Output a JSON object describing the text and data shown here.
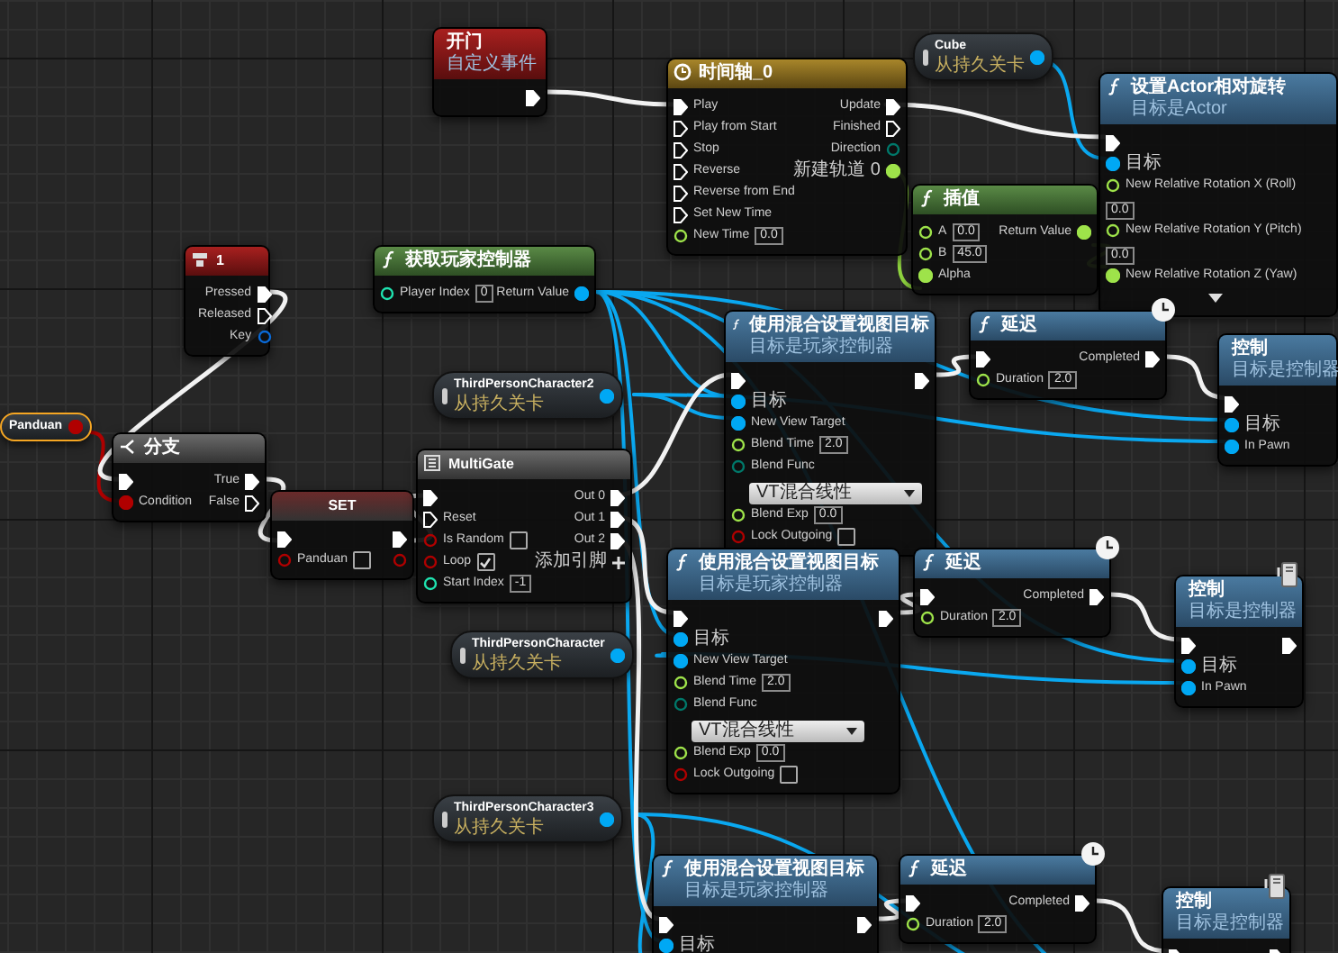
{
  "nodes": [
    {
      "kind": "event",
      "title": "开门",
      "subtitle": "自定义事件",
      "selected": false,
      "outputs": [
        {
          "kind": "exec",
          "connected": true
        }
      ]
    },
    {
      "kind": "timeline",
      "title": "时间轴_0",
      "selected": false,
      "inputs": [
        {
          "label": "Play",
          "kind": "exec",
          "connected": true
        },
        {
          "label": "Play from Start",
          "kind": "exec",
          "connected": false
        },
        {
          "label": "Stop",
          "kind": "exec",
          "connected": false
        },
        {
          "label": "Reverse",
          "kind": "exec",
          "connected": false
        },
        {
          "label": "Reverse from End",
          "kind": "exec",
          "connected": false
        },
        {
          "label": "Set New Time",
          "kind": "exec",
          "connected": false
        },
        {
          "label": "New Time",
          "kind": "float",
          "connected": false,
          "value": "0.0"
        }
      ],
      "outputs": [
        {
          "label": "Update",
          "kind": "exec",
          "connected": true
        },
        {
          "label": "Finished",
          "kind": "exec",
          "connected": false
        },
        {
          "label": "Direction",
          "kind": "byte",
          "connected": false
        },
        {
          "label": "新建轨道 0",
          "kind": "float",
          "connected": true
        }
      ]
    },
    {
      "kind": "variable",
      "title": "Cube",
      "subtitle": "从持久关卡",
      "selected": false,
      "outputs": [
        {
          "kind": "object",
          "connected": true
        }
      ]
    },
    {
      "kind": "function",
      "title": "设置Actor相对旋转",
      "subtitle": "目标是Actor",
      "selected": false,
      "inputs": [
        {
          "kind": "exec",
          "connected": true
        },
        {
          "label": "目标",
          "kind": "object",
          "connected": true
        },
        {
          "label": "New Relative Rotation X (Roll)",
          "kind": "float",
          "connected": false,
          "value": "0.0"
        },
        {
          "label": "New Relative Rotation Y (Pitch)",
          "kind": "float",
          "connected": false,
          "value": "0.0"
        },
        {
          "label": "New Relative Rotation Z (Yaw)",
          "kind": "float",
          "connected": true
        },
        {
          "kind": "expander"
        }
      ]
    },
    {
      "kind": "input_key",
      "title": "1",
      "selected": false,
      "outputs": [
        {
          "label": "Pressed",
          "kind": "exec",
          "connected": true
        },
        {
          "label": "Released",
          "kind": "exec",
          "connected": false
        },
        {
          "label": "Key",
          "kind": "struct",
          "connected": false
        }
      ]
    },
    {
      "kind": "pure_function",
      "title": "获取玩家控制器",
      "selected": false,
      "inputs": [
        {
          "label": "Player Index",
          "kind": "int",
          "connected": false,
          "value": "0"
        }
      ],
      "outputs": [
        {
          "label": "Return Value",
          "kind": "object",
          "connected": true
        }
      ]
    },
    {
      "kind": "pure_function",
      "title": "插值",
      "selected": false,
      "inputs": [
        {
          "label": "A",
          "kind": "float",
          "connected": false,
          "value": "0.0"
        },
        {
          "label": "B",
          "kind": "float",
          "connected": false,
          "value": "45.0"
        },
        {
          "label": "Alpha",
          "kind": "float",
          "connected": true
        }
      ],
      "outputs": [
        {
          "label": "Return Value",
          "kind": "float",
          "connected": true
        }
      ]
    },
    {
      "kind": "variable",
      "title": "ThirdPersonCharacter2",
      "subtitle": "从持久关卡",
      "selected": false,
      "outputs": [
        {
          "kind": "object",
          "connected": true
        }
      ]
    },
    {
      "kind": "variable",
      "title": "Panduan",
      "selected": true,
      "outputs": [
        {
          "kind": "bool",
          "connected": true
        }
      ]
    },
    {
      "kind": "branch",
      "title": "分支",
      "selected": false,
      "inputs": [
        {
          "kind": "exec",
          "connected": true
        },
        {
          "label": "Condition",
          "kind": "bool",
          "connected": true
        }
      ],
      "outputs": [
        {
          "label": "True",
          "kind": "exec",
          "connected": true
        },
        {
          "label": "False",
          "kind": "exec",
          "connected": false
        }
      ]
    },
    {
      "kind": "set",
      "title": "SET",
      "selected": false,
      "inputs": [
        {
          "kind": "exec",
          "connected": true
        },
        {
          "label": "Panduan",
          "kind": "bool",
          "connected": false,
          "checked": false
        }
      ],
      "outputs": [
        {
          "kind": "exec",
          "connected": true
        },
        {
          "kind": "bool",
          "connected": false
        }
      ]
    },
    {
      "kind": "macro",
      "title": "MultiGate",
      "selected": false,
      "inputs": [
        {
          "kind": "exec",
          "connected": true
        },
        {
          "label": "Reset",
          "kind": "exec",
          "connected": false
        },
        {
          "label": "Is Random",
          "kind": "bool",
          "connected": false,
          "checked": false
        },
        {
          "label": "Loop",
          "kind": "bool",
          "connected": false,
          "checked": true
        },
        {
          "label": "Start Index",
          "kind": "int",
          "connected": false,
          "value": "-1"
        }
      ],
      "outputs": [
        {
          "label": "Out 0",
          "kind": "exec",
          "connected": true
        },
        {
          "label": "Out 1",
          "kind": "exec",
          "connected": true
        },
        {
          "label": "Out 2",
          "kind": "exec",
          "connected": true
        },
        {
          "label": "添加引脚",
          "kind": "add_pin"
        }
      ]
    },
    {
      "kind": "function",
      "title": "使用混合设置视图目标",
      "subtitle": "目标是玩家控制器",
      "selected": false,
      "inputs": [
        {
          "kind": "exec",
          "connected": true
        },
        {
          "label": "目标",
          "kind": "object",
          "connected": true
        },
        {
          "label": "New View Target",
          "kind": "object",
          "connected": true
        },
        {
          "label": "Blend Time",
          "kind": "float",
          "connected": false,
          "value": "2.0"
        },
        {
          "label": "Blend Func",
          "kind": "byte",
          "connected": false,
          "option": "VT混合线性"
        },
        {
          "label": "Blend Exp",
          "kind": "float",
          "connected": false,
          "value": "0.0"
        },
        {
          "label": "Lock Outgoing",
          "kind": "bool",
          "connected": false,
          "checked": false
        }
      ],
      "outputs": [
        {
          "kind": "exec",
          "connected": true
        }
      ]
    },
    {
      "kind": "latent",
      "title": "延迟",
      "selected": false,
      "inputs": [
        {
          "kind": "exec",
          "connected": true
        },
        {
          "label": "Duration",
          "kind": "float",
          "connected": false,
          "value": "2.0"
        }
      ],
      "outputs": [
        {
          "label": "Completed",
          "kind": "exec",
          "connected": true
        }
      ]
    },
    {
      "kind": "function",
      "title": "控制",
      "subtitle": "目标是控制器",
      "selected": false,
      "server_only": false,
      "inputs": [
        {
          "kind": "exec",
          "connected": true
        },
        {
          "label": "目标",
          "kind": "object",
          "connected": true
        },
        {
          "label": "In Pawn",
          "kind": "object",
          "connected": true
        }
      ]
    },
    {
      "kind": "variable",
      "title": "ThirdPersonCharacter",
      "subtitle": "从持久关卡",
      "selected": false,
      "outputs": [
        {
          "kind": "object",
          "connected": true
        }
      ]
    },
    {
      "kind": "function",
      "title": "使用混合设置视图目标",
      "subtitle": "目标是玩家控制器",
      "selected": false,
      "inputs": [
        {
          "kind": "exec",
          "connected": true
        },
        {
          "label": "目标",
          "kind": "object",
          "connected": true
        },
        {
          "label": "New View Target",
          "kind": "object",
          "connected": true
        },
        {
          "label": "Blend Time",
          "kind": "float",
          "connected": false,
          "value": "2.0"
        },
        {
          "label": "Blend Func",
          "kind": "byte",
          "connected": false,
          "option": "VT混合线性"
        },
        {
          "label": "Blend Exp",
          "kind": "float",
          "connected": false,
          "value": "0.0"
        },
        {
          "label": "Lock Outgoing",
          "kind": "bool",
          "connected": false,
          "checked": false
        }
      ],
      "outputs": [
        {
          "kind": "exec",
          "connected": true
        }
      ]
    },
    {
      "kind": "latent",
      "title": "延迟",
      "selected": false,
      "inputs": [
        {
          "kind": "exec",
          "connected": true
        },
        {
          "label": "Duration",
          "kind": "float",
          "connected": false,
          "value": "2.0"
        }
      ],
      "outputs": [
        {
          "label": "Completed",
          "kind": "exec",
          "connected": true
        }
      ]
    },
    {
      "kind": "function",
      "title": "控制",
      "subtitle": "目标是控制器",
      "selected": false,
      "server_only": true,
      "inputs": [
        {
          "kind": "exec",
          "connected": true
        },
        {
          "label": "目标",
          "kind": "object",
          "connected": true
        },
        {
          "label": "In Pawn",
          "kind": "object",
          "connected": true
        }
      ],
      "outputs": [
        {
          "kind": "exec",
          "connected": true
        }
      ]
    },
    {
      "kind": "variable",
      "title": "ThirdPersonCharacter3",
      "subtitle": "从持久关卡",
      "selected": false,
      "outputs": [
        {
          "kind": "object",
          "connected": true
        }
      ]
    },
    {
      "kind": "function",
      "title": "使用混合设置视图目标",
      "subtitle": "目标是玩家控制器",
      "selected": false,
      "inputs": [
        {
          "kind": "exec",
          "connected": true
        },
        {
          "label": "目标",
          "kind": "object",
          "connected": true
        }
      ],
      "outputs": [
        {
          "kind": "exec",
          "connected": true
        }
      ]
    },
    {
      "kind": "latent",
      "title": "延迟",
      "selected": false,
      "inputs": [
        {
          "kind": "exec",
          "connected": true
        },
        {
          "label": "Duration",
          "kind": "float",
          "connected": false,
          "value": "2.0"
        }
      ],
      "outputs": [
        {
          "label": "Completed",
          "kind": "exec",
          "connected": true
        }
      ]
    },
    {
      "kind": "function",
      "title": "控制",
      "subtitle": "目标是控制器",
      "selected": false,
      "server_only": true,
      "inputs": [
        {
          "kind": "exec",
          "connected": true
        }
      ],
      "outputs": [
        {
          "kind": "exec",
          "connected": true
        }
      ]
    }
  ]
}
